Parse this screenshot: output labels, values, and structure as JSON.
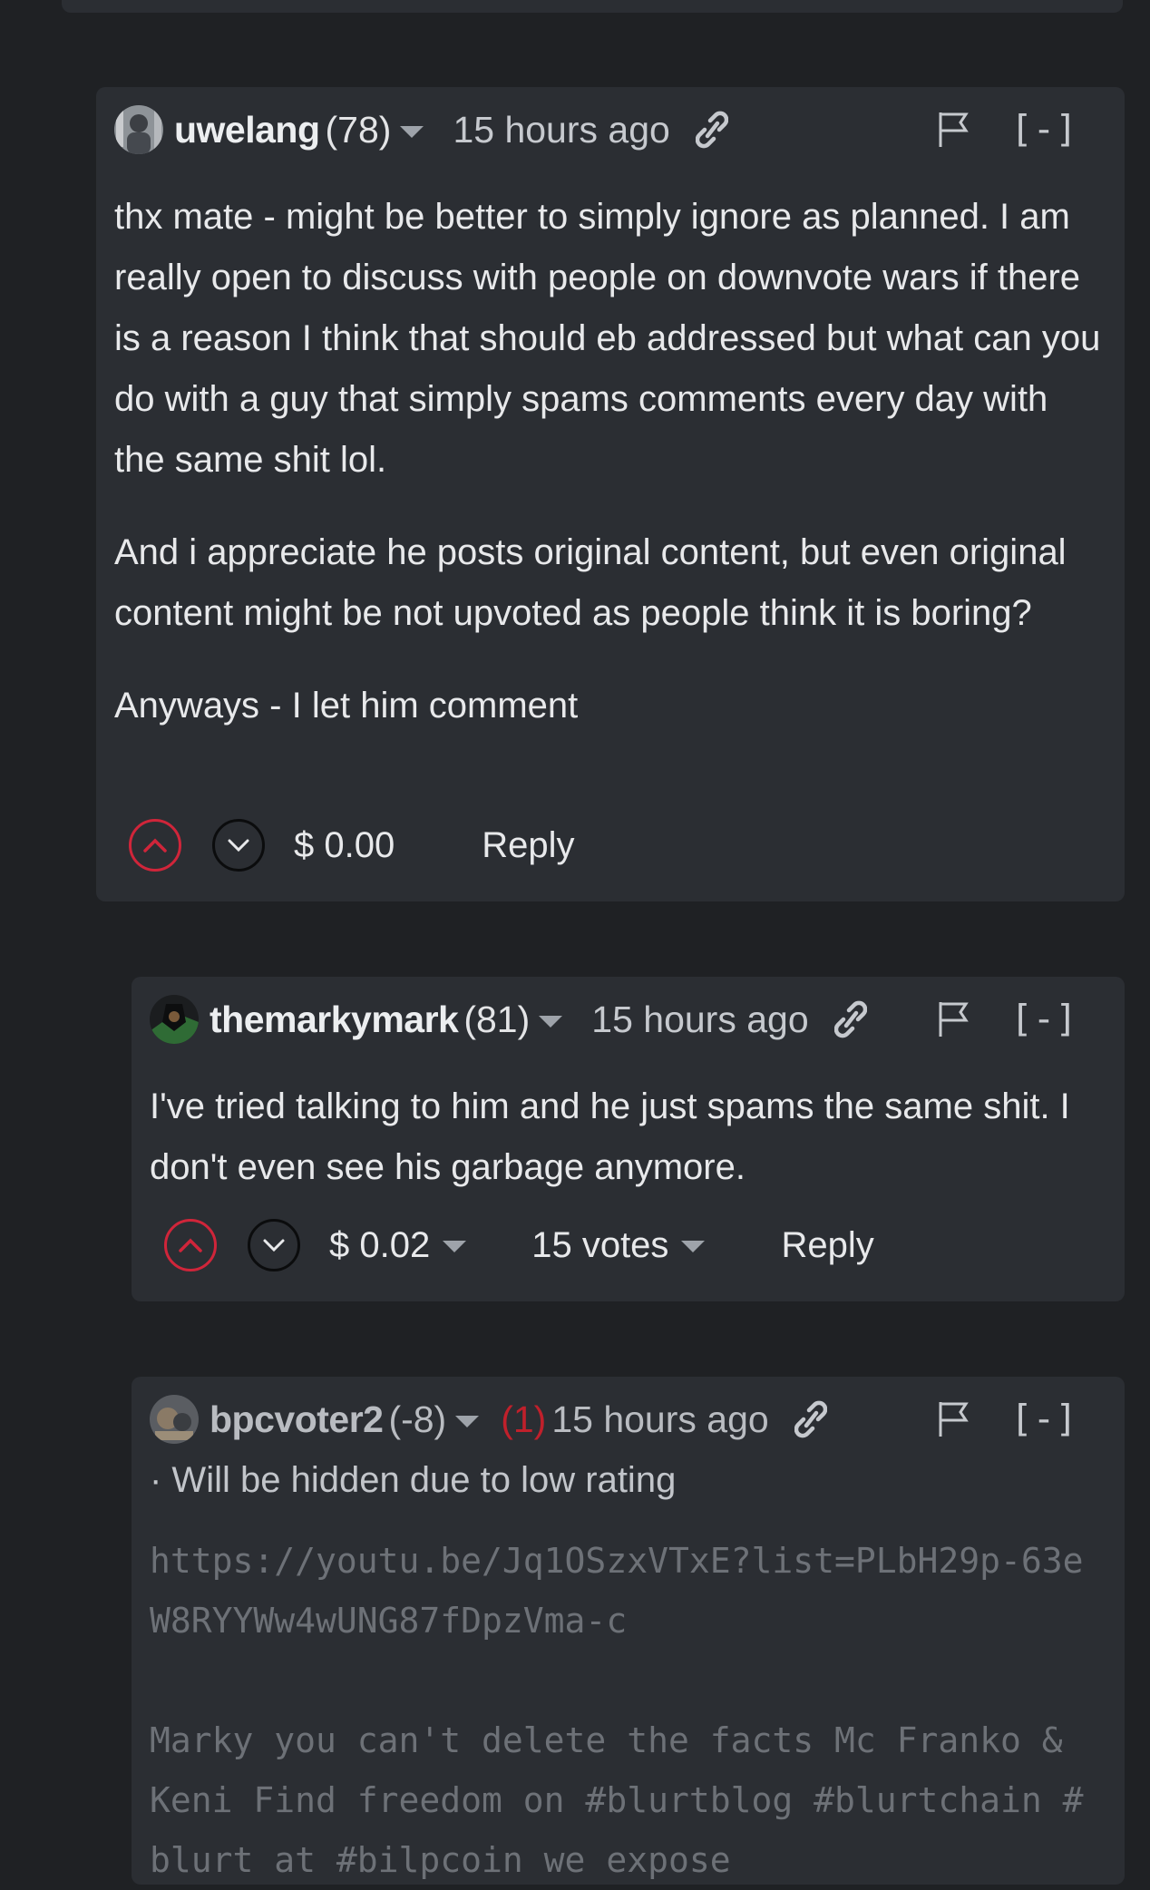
{
  "comments": [
    {
      "author": "uwelang",
      "reputation": "(78)",
      "time": "15 hours ago",
      "collapse": "[-]",
      "paragraphs": [
        "thx mate - might be better to simply ignore as planned. I am really open to discuss with people on downvote wars if there is a reason I think that should eb addressed but what can you do with a guy that simply spams comments every day with the same shit lol.",
        "And i appreciate he posts original content, but even original content might be not upvoted as people think it is boring?",
        "Anyways - I let him comment"
      ],
      "payout": "$ 0.00",
      "reply": "Reply"
    },
    {
      "author": "themarkymark",
      "reputation": "(81)",
      "time": "15 hours ago",
      "collapse": "[-]",
      "paragraphs": [
        "I've tried talking to him and he just spams the same shit. I don't even see his garbage anymore."
      ],
      "payout": "$ 0.02",
      "votes": "15 votes",
      "reply": "Reply"
    },
    {
      "author": "bpcvoter2",
      "reputation": "(-8)",
      "flag_count": "(1)",
      "time": "15 hours ago",
      "collapse": "[-]",
      "hidden_note": "· Will be hidden due to low rating",
      "hidden_text": "https://youtu.be/Jq1OSzxVTxE?list=PLbH29p-63eW8RYYWw4wUNG87fDpzVma-c\n\nMarky you can't delete the facts Mc Franko & Keni Find freedom on #blurtblog #blurtchain #blurt at #bilpcoin we expose"
    }
  ],
  "colors": {
    "background": "#1f2124",
    "card": "#2b2e33",
    "upvote": "#d0253a",
    "flag_count": "#c0202b"
  },
  "icons": [
    "avatar",
    "chevron-down-icon",
    "link-icon",
    "flag-icon",
    "upvote-icon",
    "downvote-icon"
  ]
}
